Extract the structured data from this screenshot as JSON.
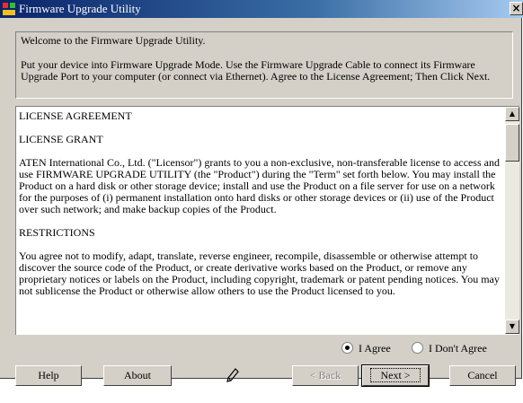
{
  "window": {
    "title": "Firmware Upgrade Utility",
    "close_label": "×"
  },
  "welcome": {
    "line1": "Welcome to the Firmware Upgrade Utility.",
    "line2": "Put your device into Firmware Upgrade Mode. Use the Firmware Upgrade Cable to connect its Firmware Upgrade Port to your computer (or connect via Ethernet). Agree to the License Agreement; Then Click Next."
  },
  "license": {
    "heading": "LICENSE AGREEMENT",
    "grant_heading": "LICENSE GRANT",
    "grant_text": "ATEN International Co., Ltd. (\"Licensor\") grants to you a non-exclusive, non-transferable license to access and use FIRMWARE UPGRADE UTILITY (the \"Product\") during the \"Term\" set forth below. You may install the Product on a hard disk or other storage device; install and use the Product on a file server for use on a network for the purposes of (i) permanent installation onto hard disks or other storage devices or (ii) use of the Product over such network; and make backup copies of the Product.",
    "restrictions_heading": "RESTRICTIONS",
    "restrictions_text": "You agree not to modify, adapt, translate, reverse engineer, recompile, disassemble or otherwise attempt to discover the source code of the Product, or create derivative works based on the Product, or remove any proprietary notices or labels on the Product, including copyright, trademark or patent pending notices. You may not sublicense the Product or otherwise allow others to use the Product licensed to you.",
    "scroll_up": "▲",
    "scroll_down": "▼"
  },
  "agreement": {
    "agree_label": "I Agree",
    "disagree_label": "I Don't Agree",
    "selected": "agree"
  },
  "buttons": {
    "help": "Help",
    "about": "About",
    "back": "< Back",
    "next": "Next >",
    "cancel": "Cancel"
  },
  "colors": {
    "titlebar": "#0a246a",
    "face": "#d4d0c8"
  }
}
